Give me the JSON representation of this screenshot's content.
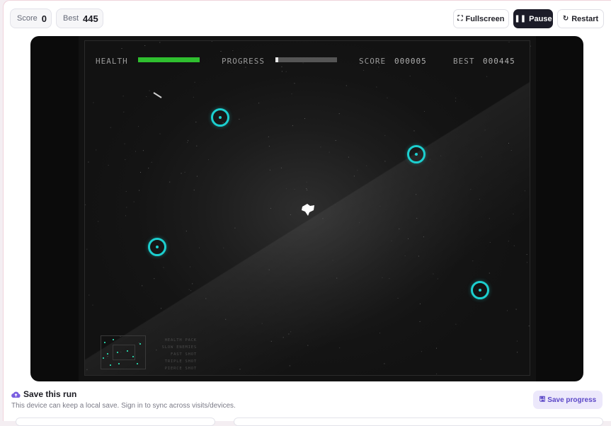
{
  "header": {
    "score_label": "Score",
    "score_value": "0",
    "best_label": "Best",
    "best_value": "445",
    "fullscreen_label": "Fullscreen",
    "pause_label": "Pause",
    "restart_label": "Restart"
  },
  "hud": {
    "health_label": "HEALTH",
    "health_fraction": 1.0,
    "progress_label": "PROGRESS",
    "progress_fraction": 0.05,
    "score_label": "SCORE",
    "score_value": "000005",
    "best_label": "BEST",
    "best_value": "000445"
  },
  "powerups": [
    "HEALTH PACK",
    "SLOW ENEMIES",
    "FAST SHOT",
    "TRIPLE SHOT",
    "PIERCE SHOT"
  ],
  "save": {
    "title": "Save this run",
    "subtitle": "This device can keep a local save. Sign in to sync across visits/devices.",
    "button_label": "Save progress"
  },
  "colors": {
    "accent": "#1ccfcf",
    "health": "#2fbf2f",
    "pause_bg": "#1c1c28",
    "save_accent": "#5b47c7"
  }
}
